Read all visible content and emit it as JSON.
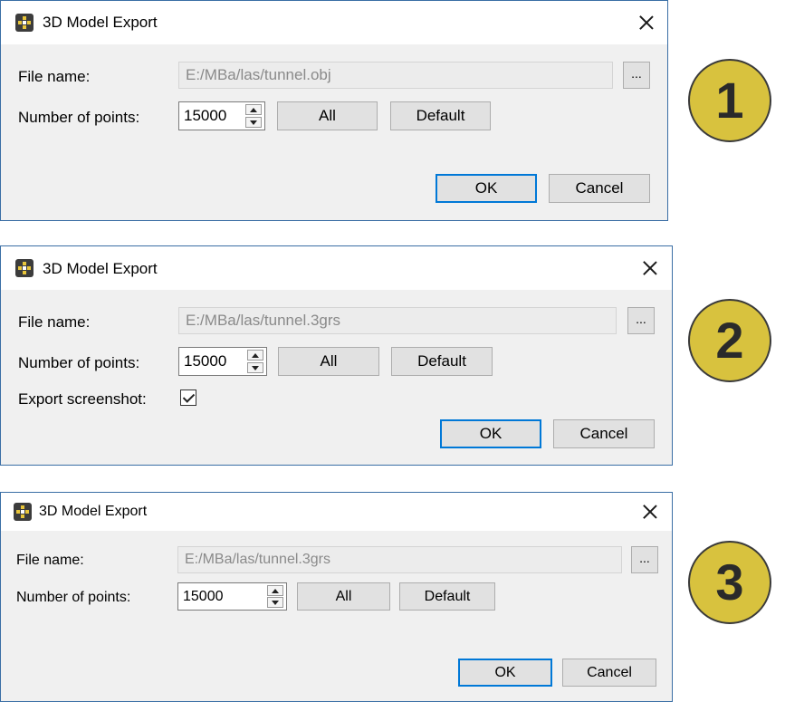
{
  "colors": {
    "dialog_bg": "#f0f0f0",
    "titlebar_bg": "#ffffff",
    "default_button_border": "#0078d7",
    "badge_fill": "#d8c23e"
  },
  "dialogs": [
    {
      "title": "3D Model Export",
      "file_name_label": "File name:",
      "file_name_value": "E:/MBa/las/tunnel.obj",
      "browse_label": "...",
      "points_label": "Number of points:",
      "points_value": "15000",
      "all_label": "All",
      "default_label": "Default",
      "ok_label": "OK",
      "cancel_label": "Cancel",
      "badge": "1"
    },
    {
      "title": "3D Model Export",
      "file_name_label": "File name:",
      "file_name_value": "E:/MBa/las/tunnel.3grs",
      "browse_label": "...",
      "points_label": "Number of points:",
      "points_value": "15000",
      "all_label": "All",
      "default_label": "Default",
      "screenshot_label": "Export screenshot:",
      "screenshot_checked": true,
      "ok_label": "OK",
      "cancel_label": "Cancel",
      "badge": "2"
    },
    {
      "title": "3D Model Export",
      "file_name_label": "File name:",
      "file_name_value": "E:/MBa/las/tunnel.3grs",
      "browse_label": "...",
      "points_label": "Number of points:",
      "points_value": "15000",
      "all_label": "All",
      "default_label": "Default",
      "ok_label": "OK",
      "cancel_label": "Cancel",
      "badge": "3"
    }
  ]
}
